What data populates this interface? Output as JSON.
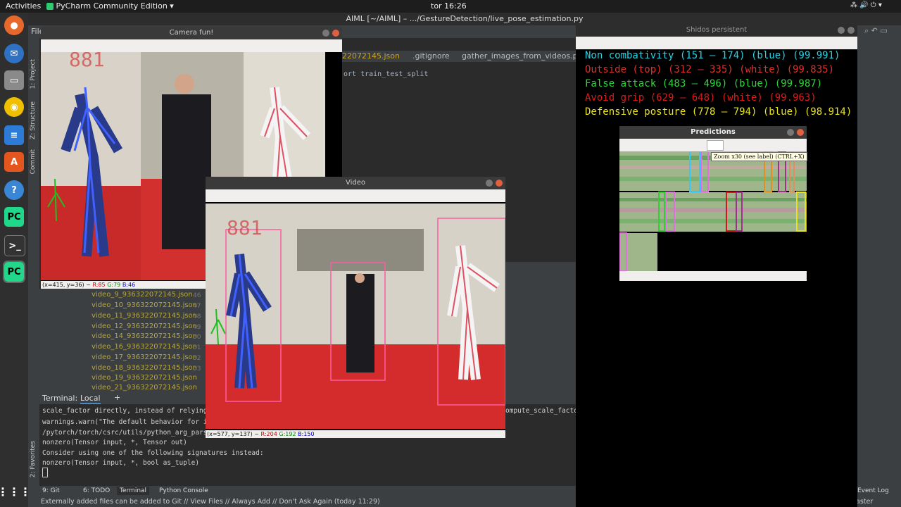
{
  "topbar": {
    "activities": "Activities",
    "app": "PyCharm Community Edition ▾",
    "clock": "tor 16:26"
  },
  "pycharm": {
    "window_title": "AIML [~/AIML] – .../GestureDetection/live_pose_estimation.py",
    "tabs": [
      "22072145.json",
      "gitignore",
      "gather_images_from_videos.py"
    ],
    "editor_line": "ort train_test_split",
    "side_labels": {
      "project": "1: Project",
      "structure": "Z: Structure",
      "commit": "Commit",
      "favorites": "2: Favorites"
    },
    "files": [
      "video_9_936322072145.json",
      "video_10_936322072145.json",
      "video_11_936322072145.json",
      "video_12_936322072145.json",
      "video_14_936322072145.json",
      "video_16_936322072145.json",
      "video_17_936322072145.json",
      "video_18_936322072145.json",
      "video_19_936322072145.json",
      "video_21_936322072145.json"
    ],
    "gutter": [
      "46",
      "47",
      "48",
      "49",
      "50",
      "51",
      "52",
      "53"
    ],
    "terminal": {
      "label": "Terminal:",
      "tab": "Local",
      "add": "+",
      "lines": [
        "scale_factor directly, instead of relying on",
        "  warnings.warn(\"The default behavior for in",
        "/pytorch/torch/csrc/utils/python_arg_parser.",
        "        nonzero(Tensor input, *, Tensor out)",
        "Consider using one of the following signatures instead:",
        "        nonzero(Tensor input, *, bool as_tuple)"
      ],
      "right_fragment": "ompute_scale_factor"
    },
    "bottom_tabs": [
      "9: Git",
      "6: TODO",
      "Terminal",
      "Python Console"
    ],
    "event_log": "Event Log",
    "branch": "aster",
    "status": "Externally added files can be added to Git // View Files // Always Add // Don't Ask Again (today 11:29)",
    "menu_file": "File"
  },
  "camera_window": {
    "title": "Camera fun!",
    "frame_number": "881",
    "coord": "(x=415, y=36) ~",
    "r": "R:85",
    "g": "G:79",
    "b": "B:46"
  },
  "video_window": {
    "title": "Video",
    "frame_number": "881",
    "coord": "(x=577, y=137) ~",
    "r": "R:204",
    "g": "G:192",
    "b": "B:150"
  },
  "shidos_window": {
    "title": "Shidos persistent",
    "predictions": [
      {
        "text": "Non combativity (151 – 174) (blue) (99.991)",
        "color": "#27d3e6"
      },
      {
        "text": "Outside (top) (312 – 335) (white) (99.835)",
        "color": "#e0302a"
      },
      {
        "text": "False attack (483 – 496) (blue) (99.987)",
        "color": "#2dd63a"
      },
      {
        "text": "Avoid grip (629 – 648) (white) (99.963)",
        "color": "#e01a1a"
      },
      {
        "text": "Defensive posture (778 – 794) (blue) (98.914)",
        "color": "#e8e320"
      }
    ]
  },
  "predictions_window": {
    "title": "Predictions",
    "tooltip": "Zoom x30 (see label) (CTRL+X)"
  }
}
